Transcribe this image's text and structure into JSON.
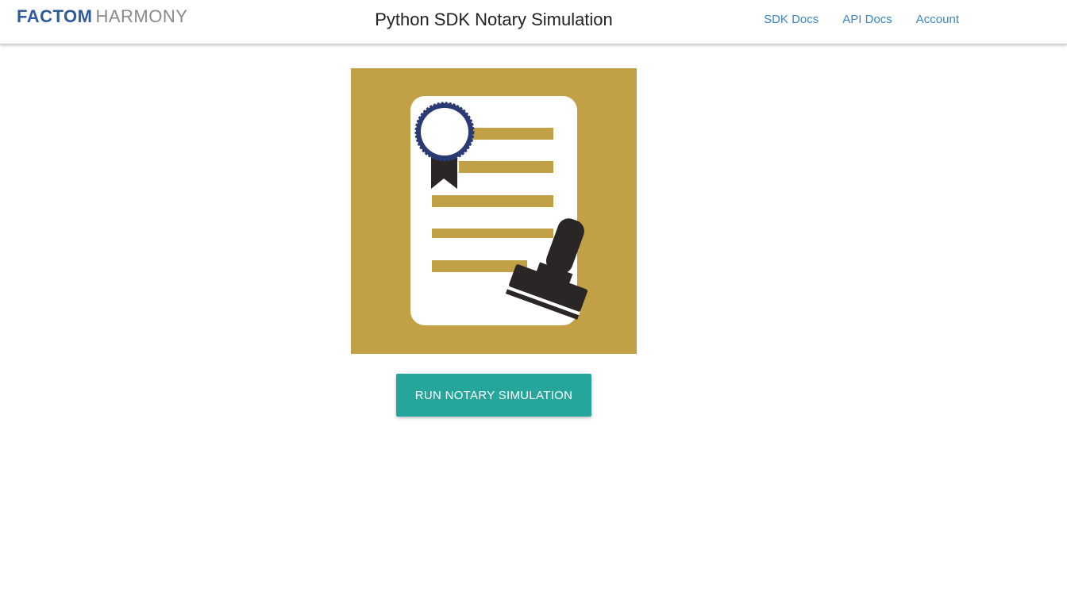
{
  "header": {
    "logo_bold": "FACTOM",
    "logo_light": "HARMONY",
    "title": "Python SDK Notary Simulation",
    "nav": [
      {
        "label": "SDK Docs"
      },
      {
        "label": "API Docs"
      },
      {
        "label": "Account"
      }
    ]
  },
  "main": {
    "illustration": {
      "icon": "notarized-document-icon",
      "background_color": "#c1a046"
    },
    "run_button_label": "RUN NOTARY SIMULATION"
  },
  "colors": {
    "brand_blue": "#2e5b9e",
    "link": "#3a86c8",
    "accent_teal": "#26a69a",
    "gold": "#c1a046",
    "ribbon_navy": "#2a3a73",
    "stamp_dark": "#2b2626"
  }
}
